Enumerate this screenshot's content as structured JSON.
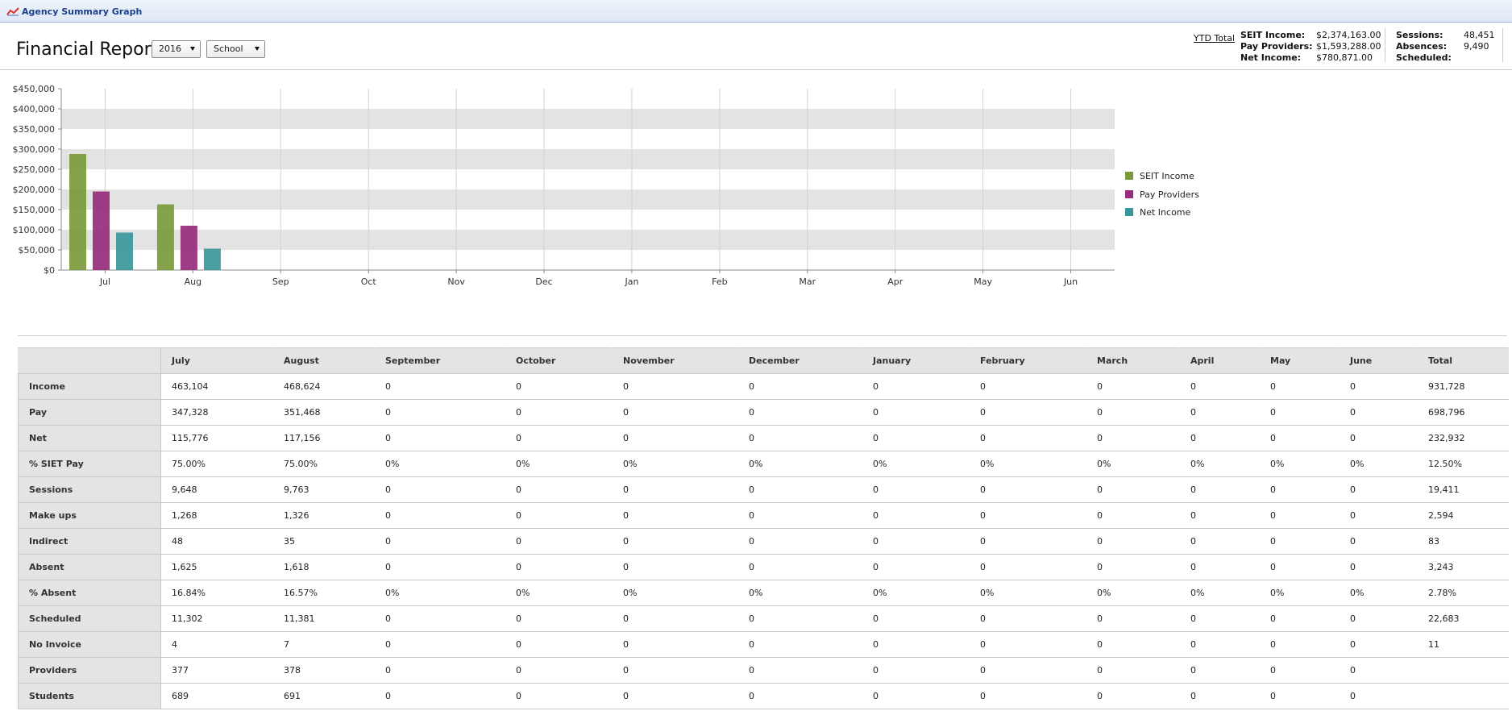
{
  "window": {
    "title": "Agency Summary Graph",
    "icon": "chart-line-icon"
  },
  "header": {
    "title": "Financial Report",
    "year_select": "2016",
    "type_select": "School",
    "ytd_link": "YTD Total",
    "stats": {
      "seit_income_label": "SEIT Income:",
      "seit_income_value": "$2,374,163.00",
      "pay_providers_label": "Pay Providers:",
      "pay_providers_value": "$1,593,288.00",
      "net_income_label": "Net Income:",
      "net_income_value": "$780,871.00",
      "sessions_label": "Sessions:",
      "sessions_value": "48,451",
      "absences_label": "Absences:",
      "absences_value": "9,490",
      "scheduled_label": "Scheduled:",
      "scheduled_value": ""
    }
  },
  "chart_data": {
    "type": "bar",
    "categories": [
      "Jul",
      "Aug",
      "Sep",
      "Oct",
      "Nov",
      "Dec",
      "Jan",
      "Feb",
      "Mar",
      "Apr",
      "May",
      "Jun"
    ],
    "series": [
      {
        "name": "SEIT Income",
        "color": "#7a9a3a",
        "values": [
          288000,
          163000,
          0,
          0,
          0,
          0,
          0,
          0,
          0,
          0,
          0,
          0
        ]
      },
      {
        "name": "Pay Providers",
        "color": "#962c7b",
        "values": [
          195000,
          110000,
          0,
          0,
          0,
          0,
          0,
          0,
          0,
          0,
          0,
          0
        ]
      },
      {
        "name": "Net Income",
        "color": "#3a9799",
        "values": [
          93000,
          53000,
          0,
          0,
          0,
          0,
          0,
          0,
          0,
          0,
          0,
          0
        ]
      }
    ],
    "yticks": [
      "$0",
      "$50,000",
      "$100,000",
      "$150,000",
      "$200,000",
      "$250,000",
      "$300,000",
      "$350,000",
      "$400,000",
      "$450,000"
    ],
    "ylim": [
      0,
      450000
    ],
    "grid": true,
    "legend": "right"
  },
  "table": {
    "headers": [
      "",
      "July",
      "August",
      "September",
      "October",
      "November",
      "December",
      "January",
      "February",
      "March",
      "April",
      "May",
      "June",
      "Total"
    ],
    "rows": [
      [
        "Income",
        "463,104",
        "468,624",
        "0",
        "0",
        "0",
        "0",
        "0",
        "0",
        "0",
        "0",
        "0",
        "0",
        "931,728"
      ],
      [
        "Pay",
        "347,328",
        "351,468",
        "0",
        "0",
        "0",
        "0",
        "0",
        "0",
        "0",
        "0",
        "0",
        "0",
        "698,796"
      ],
      [
        "Net",
        "115,776",
        "117,156",
        "0",
        "0",
        "0",
        "0",
        "0",
        "0",
        "0",
        "0",
        "0",
        "0",
        "232,932"
      ],
      [
        "% SIET Pay",
        "75.00%",
        "75.00%",
        "0%",
        "0%",
        "0%",
        "0%",
        "0%",
        "0%",
        "0%",
        "0%",
        "0%",
        "0%",
        "12.50%"
      ],
      [
        "Sessions",
        "9,648",
        "9,763",
        "0",
        "0",
        "0",
        "0",
        "0",
        "0",
        "0",
        "0",
        "0",
        "0",
        "19,411"
      ],
      [
        "Make ups",
        "1,268",
        "1,326",
        "0",
        "0",
        "0",
        "0",
        "0",
        "0",
        "0",
        "0",
        "0",
        "0",
        "2,594"
      ],
      [
        "Indirect",
        "48",
        "35",
        "0",
        "0",
        "0",
        "0",
        "0",
        "0",
        "0",
        "0",
        "0",
        "0",
        "83"
      ],
      [
        "Absent",
        "1,625",
        "1,618",
        "0",
        "0",
        "0",
        "0",
        "0",
        "0",
        "0",
        "0",
        "0",
        "0",
        "3,243"
      ],
      [
        "% Absent",
        "16.84%",
        "16.57%",
        "0%",
        "0%",
        "0%",
        "0%",
        "0%",
        "0%",
        "0%",
        "0%",
        "0%",
        "0%",
        "2.78%"
      ],
      [
        "Scheduled",
        "11,302",
        "11,381",
        "0",
        "0",
        "0",
        "0",
        "0",
        "0",
        "0",
        "0",
        "0",
        "0",
        "22,683"
      ],
      [
        "No Invoice",
        "4",
        "7",
        "0",
        "0",
        "0",
        "0",
        "0",
        "0",
        "0",
        "0",
        "0",
        "0",
        "11"
      ],
      [
        "Providers",
        "377",
        "378",
        "0",
        "0",
        "0",
        "0",
        "0",
        "0",
        "0",
        "0",
        "0",
        "0",
        ""
      ],
      [
        "Students",
        "689",
        "691",
        "0",
        "0",
        "0",
        "0",
        "0",
        "0",
        "0",
        "0",
        "0",
        "0",
        ""
      ]
    ]
  }
}
